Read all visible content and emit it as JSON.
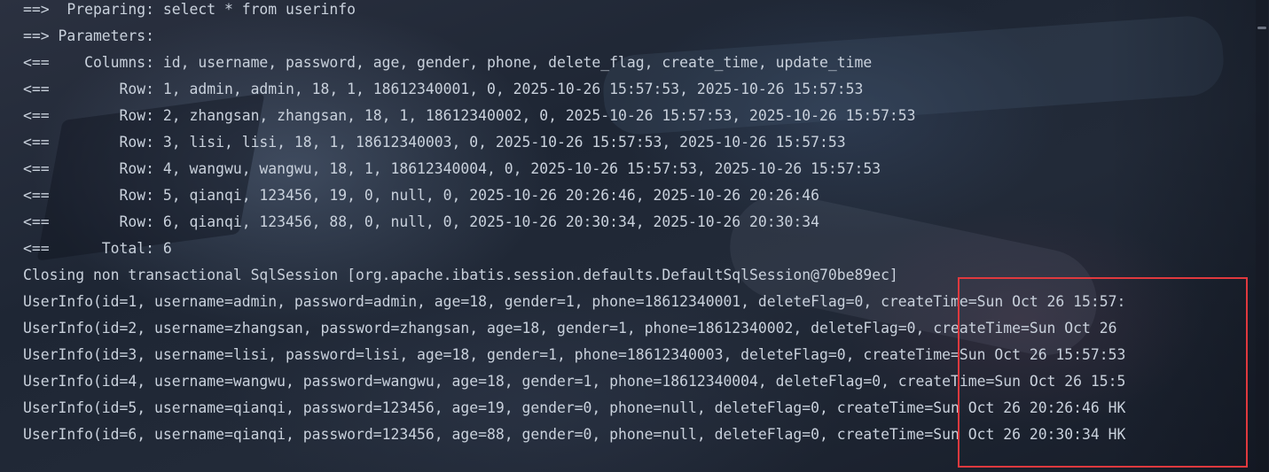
{
  "console": {
    "lines": [
      "==>  Preparing: select * from userinfo",
      "==> Parameters: ",
      "<==    Columns: id, username, password, age, gender, phone, delete_flag, create_time, update_time",
      "<==        Row: 1, admin, admin, 18, 1, 18612340001, 0, 2025-10-26 15:57:53, 2025-10-26 15:57:53",
      "<==        Row: 2, zhangsan, zhangsan, 18, 1, 18612340002, 0, 2025-10-26 15:57:53, 2025-10-26 15:57:53",
      "<==        Row: 3, lisi, lisi, 18, 1, 18612340003, 0, 2025-10-26 15:57:53, 2025-10-26 15:57:53",
      "<==        Row: 4, wangwu, wangwu, 18, 1, 18612340004, 0, 2025-10-26 15:57:53, 2025-10-26 15:57:53",
      "<==        Row: 5, qianqi, 123456, 19, 0, null, 0, 2025-10-26 20:26:46, 2025-10-26 20:26:46",
      "<==        Row: 6, qianqi, 123456, 88, 0, null, 0, 2025-10-26 20:30:34, 2025-10-26 20:30:34",
      "<==      Total: 6",
      "Closing non transactional SqlSession [org.apache.ibatis.session.defaults.DefaultSqlSession@70be89ec]",
      "UserInfo(id=1, username=admin, password=admin, age=18, gender=1, phone=18612340001, deleteFlag=0, createTime=Sun Oct 26 15:57:",
      "UserInfo(id=2, username=zhangsan, password=zhangsan, age=18, gender=1, phone=18612340002, deleteFlag=0, createTime=Sun Oct 26",
      "UserInfo(id=3, username=lisi, password=lisi, age=18, gender=1, phone=18612340003, deleteFlag=0, createTime=Sun Oct 26 15:57:53",
      "UserInfo(id=4, username=wangwu, password=wangwu, age=18, gender=1, phone=18612340004, deleteFlag=0, createTime=Sun Oct 26 15:5",
      "UserInfo(id=5, username=qianqi, password=123456, age=19, gender=0, phone=null, deleteFlag=0, createTime=Sun Oct 26 20:26:46 HK",
      "UserInfo(id=6, username=qianqi, password=123456, age=88, gender=0, phone=null, deleteFlag=0, createTime=Sun Oct 26 20:30:34 HK"
    ]
  },
  "colors": {
    "text": "#c9d1dc",
    "highlight_border": "#e0393e"
  }
}
